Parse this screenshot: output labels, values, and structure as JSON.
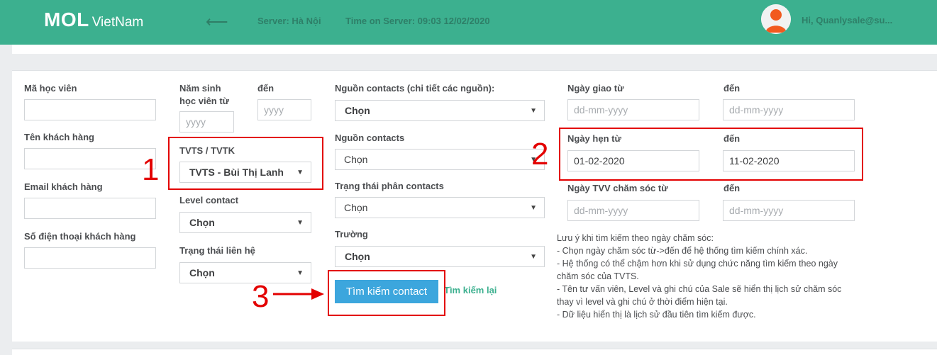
{
  "header": {
    "logo_main": "MOL",
    "logo_sub": "VietNam",
    "back_icon": "arrow-left-icon",
    "server": "Server: Hà Nội",
    "time": "Time on Server: 09:03 12/02/2020",
    "greeting": "Hi, Quanlysale@su...",
    "colors": {
      "bar": "#3cb08f",
      "text": "#2e7f68"
    }
  },
  "form": {
    "ma_hoc_vien": {
      "label": "Mã học viên",
      "value": ""
    },
    "ten_khach_hang": {
      "label": "Tên khách hàng",
      "value": ""
    },
    "email": {
      "label": "Email khách hàng",
      "value": ""
    },
    "so_dien_thoai": {
      "label": "Số điện thoại khách hàng",
      "value": ""
    },
    "nam_sinh": {
      "label_line1": "Năm sinh",
      "label_line2": "học viên từ",
      "placeholder": "yyyy",
      "to_label": "đến",
      "to_placeholder": "yyyy"
    },
    "tvts": {
      "label": "TVTS / TVTK",
      "value": "TVTS - Bùi Thị Lanh"
    },
    "level_contact": {
      "label": "Level contact",
      "value": "Chọn"
    },
    "trang_thai_lien_he": {
      "label": "Trạng thái liên hệ",
      "value": "Chọn"
    },
    "nguon_chi_tiet": {
      "label": "Nguồn contacts (chi tiết các nguồn):",
      "value": "Chọn"
    },
    "nguon_contacts": {
      "label": "Nguồn contacts",
      "value": "Chọn"
    },
    "trang_thai_phan": {
      "label": "Trạng thái phân contacts",
      "value": "Chọn"
    },
    "truong": {
      "label": "Trường",
      "value": "Chọn"
    },
    "ngay_giao": {
      "label": "Ngày giao từ",
      "placeholder": "dd-mm-yyyy",
      "to_label": "đến",
      "to_placeholder": "dd-mm-yyyy"
    },
    "ngay_hen": {
      "label": "Ngày hẹn từ",
      "value": "01-02-2020",
      "to_label": "đến",
      "to_value": "11-02-2020"
    },
    "ngay_tvv": {
      "label": "Ngày TVV chăm sóc từ",
      "placeholder": "dd-mm-yyyy",
      "to_label": "đến",
      "to_placeholder": "dd-mm-yyyy"
    },
    "search_button": "Tìm kiếm contact",
    "reset_link": "Tìm kiếm lại"
  },
  "notes": [
    "Lưu ý khi tìm kiếm theo ngày chăm sóc:",
    "- Chọn ngày chăm sóc từ->đến để hệ thống tìm kiếm chính xác.",
    "- Hệ thống có thể chậm hơn khi sử dụng chức năng tìm kiếm theo ngày",
    "chăm sóc của TVTS.",
    "- Tên tư vấn viên, Level và ghi chú của Sale sẽ hiển thị lịch sử chăm sóc",
    "thay vì level và ghi chú ở thời điểm hiện tại.",
    "- Dữ liệu hiển thị là lịch sử đầu tiên tìm kiếm được."
  ],
  "annotations": {
    "n1": "1",
    "n2": "2",
    "n3": "3",
    "color": "#e30000"
  }
}
